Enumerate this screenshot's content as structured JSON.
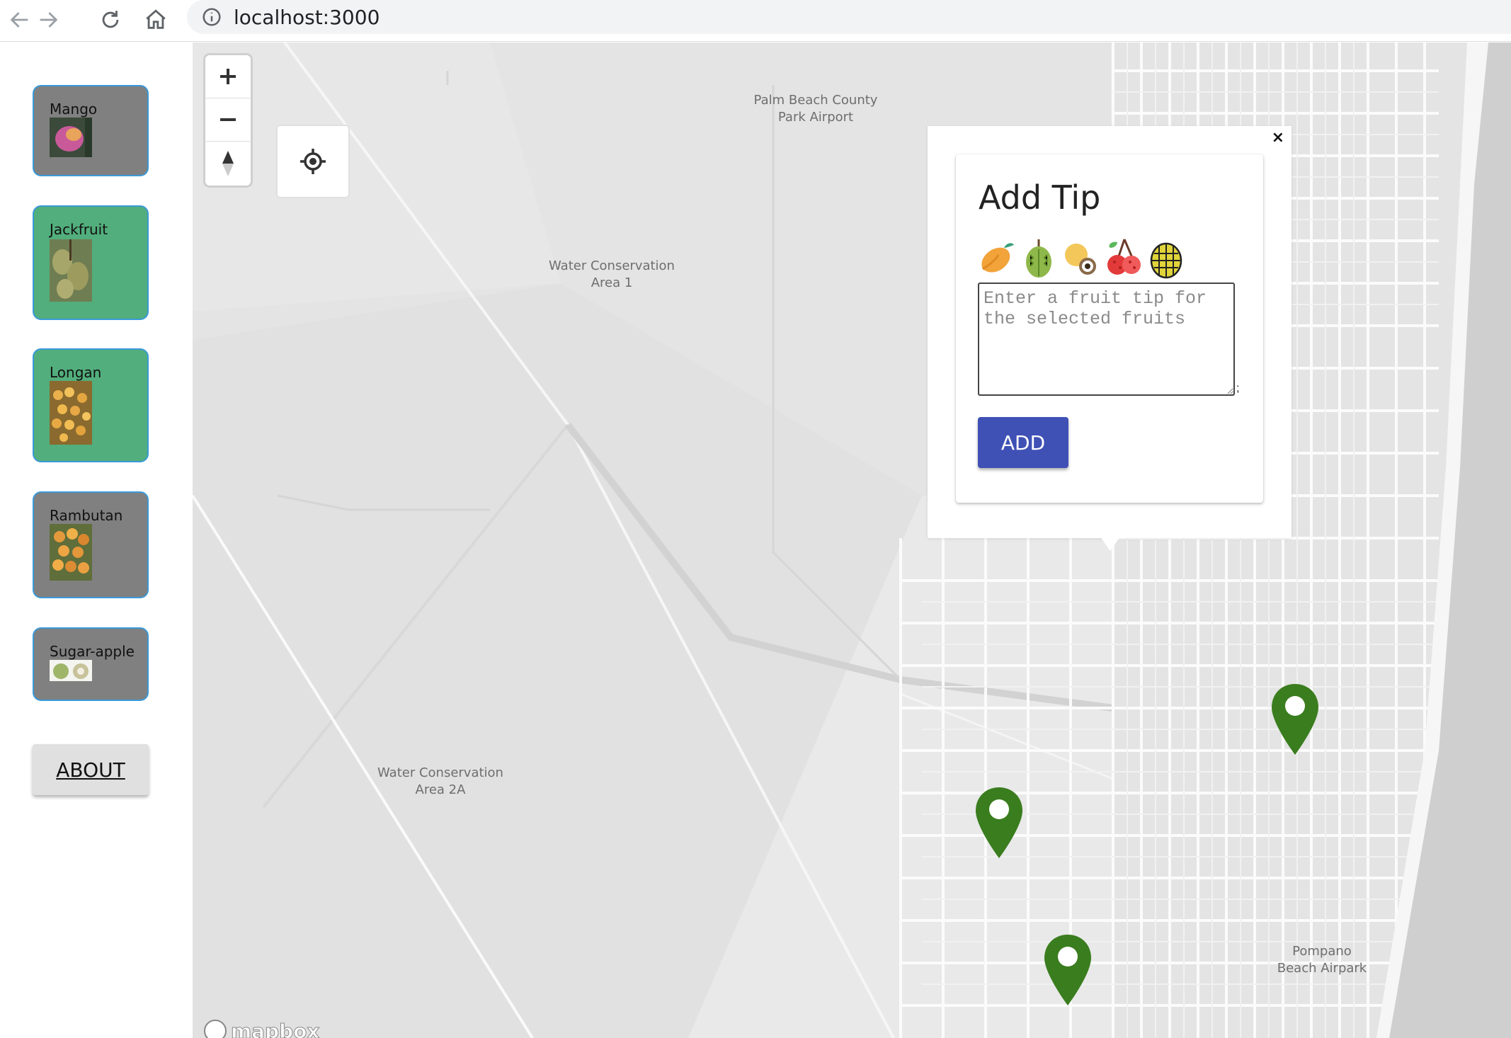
{
  "browser": {
    "url": "localhost:3000",
    "back_icon": "arrow-left-icon",
    "forward_icon": "arrow-right-icon",
    "reload_icon": "reload-icon",
    "home_icon": "home-icon",
    "info_icon": "info-icon"
  },
  "sidebar": {
    "fruits": [
      {
        "name": "Mango",
        "selected": false
      },
      {
        "name": "Jackfruit",
        "selected": true
      },
      {
        "name": "Longan",
        "selected": true
      },
      {
        "name": "Rambutan",
        "selected": false
      },
      {
        "name": "Sugar-apple",
        "selected": false
      }
    ],
    "about_label": "ABOUT",
    "colors": {
      "selected": "#52ae7c",
      "unselected": "#808080",
      "border": "#3a9ad9"
    }
  },
  "map": {
    "labels": {
      "palm_beach": "Palm Beach County\nPark Airport",
      "wca1": "Water Conservation\nArea 1",
      "wca2a": "Water Conservation\nArea 2A",
      "pompano": "Pompano\nBeach Airpark"
    },
    "attribution": "mapbox",
    "marker_color": "#3a7d1e",
    "marker_count": 3
  },
  "popup": {
    "title": "Add Tip",
    "fruit_icons": [
      "mango-icon",
      "durian-icon",
      "longan-icon",
      "rambutan-icon",
      "sugar-apple-icon"
    ],
    "textarea_placeholder": "Enter a fruit tip for the selected fruits",
    "textarea_value": "",
    "trailing_text": ";",
    "add_label": "ADD",
    "close_label": "×",
    "button_color": "#3f51b5"
  }
}
